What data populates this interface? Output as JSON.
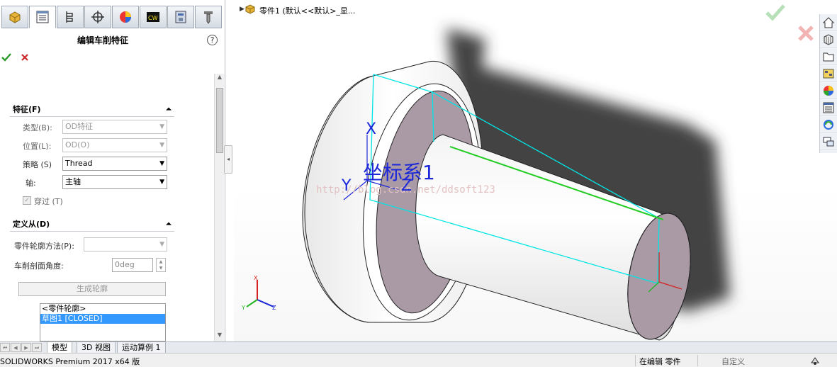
{
  "property_manager": {
    "title": "编辑车削特征",
    "help_glyph": "?",
    "tabs": [
      "part-manager-icon",
      "property-manager-icon",
      "configuration-manager-icon",
      "dimxpert-icon",
      "display-manager-icon",
      "cam-icon",
      "cam-operation-icon",
      "cam-tool-icon"
    ],
    "feature_group": {
      "title": "特征(F)",
      "type_label": "类型(B):",
      "type_value": "OD特征",
      "position_label": "位置(L):",
      "position_value": "OD(O)",
      "strategy_label": "策略 (S)",
      "strategy_value": "Thread",
      "axis_label": "轴:",
      "axis_value": "主轴",
      "through_label": "穿过 (T)",
      "through_checked": true
    },
    "define_from_group": {
      "title": "定义从(D)",
      "profile_method_label": "零件轮廓方法(P):",
      "profile_method_value": "",
      "section_angle_label": "车削剖面角度:",
      "section_angle_value": "0deg",
      "generate_profile_label": "生成轮廓",
      "profile_list": [
        "<零件轮廓>",
        "草图1 [CLOSED]"
      ],
      "profile_list_selected": 1
    }
  },
  "viewport": {
    "tree_part_label": "零件1  (默认<<默认>_显...",
    "coord_system_label": "坐标系1",
    "axis_label_x": "X",
    "axis_label_y": "Y",
    "axis_label_z": "Z",
    "watermark": "http://blog.csdn.net/ddsoft123",
    "triad_labels": {
      "x": "X",
      "y": "Y",
      "z": "Z"
    },
    "colors": {
      "face": "#a99aa6",
      "edge": "#00e5e5",
      "thread_edge": "#22cc22",
      "shadow": "#3a3a3a",
      "coord": "#1b27d9"
    }
  },
  "task_pane": [
    "home-icon",
    "design-library-icon",
    "file-explorer-icon",
    "view-palette-icon",
    "appearances-icon",
    "custom-properties-icon",
    "solidworks-forum-icon",
    "chat-icon"
  ],
  "bottom_tabs": {
    "model": "模型",
    "view3d": "3D 视图",
    "motion": "运动算例 1"
  },
  "status_bar": {
    "product": "SOLIDWORKS Premium 2017 x64 版",
    "editing": "在编辑 零件",
    "custom": "自定义"
  }
}
